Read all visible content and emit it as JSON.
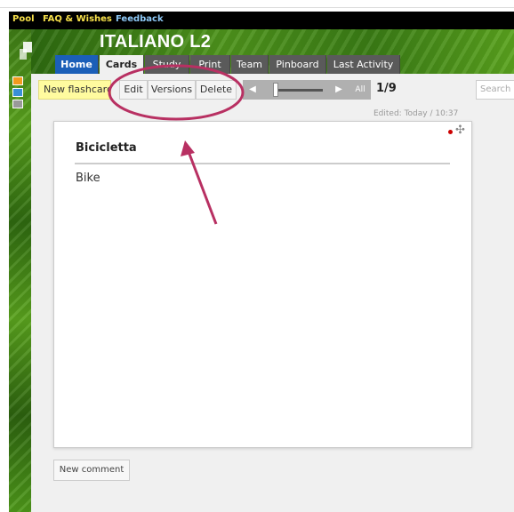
{
  "topbar": {
    "pool": "Pool",
    "faq": "FAQ & Wishes",
    "feedback": "Feedback"
  },
  "app": {
    "title": "ITALIANO L2"
  },
  "tabs": [
    "Home",
    "Cards",
    "Study",
    "Print",
    "Team",
    "Pinboard",
    "Last Activity"
  ],
  "toolbar": {
    "new_flashcard": "New flashcard",
    "edit": "Edit",
    "versions": "Versions",
    "delete": "Delete",
    "all": "All",
    "counter": "1/9",
    "search_placeholder": "Search",
    "slider_position": 0.0
  },
  "card": {
    "edited": "Edited: Today / 10:37",
    "front": "Bicicletta",
    "back": "Bike"
  },
  "comment": {
    "new_comment": "New comment"
  },
  "colors": {
    "accent": "#b83062",
    "home_tab": "#1b5fb8",
    "new_flashcard": "#fffb9f",
    "unsaved_dot": "#cc0000"
  }
}
